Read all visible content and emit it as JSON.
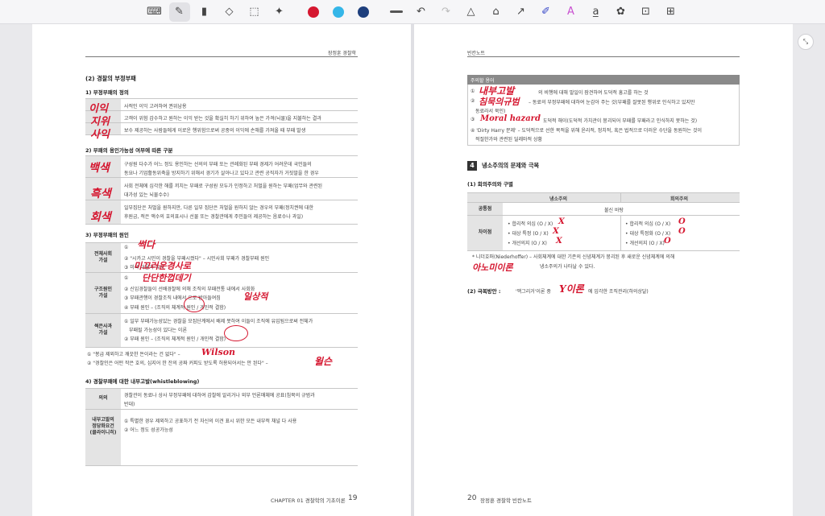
{
  "toolbar": {
    "tools": [
      {
        "name": "keyboard-icon",
        "glyph": "⌨"
      },
      {
        "name": "pen-icon",
        "glyph": "✎"
      },
      {
        "name": "highlighter-icon",
        "glyph": "▮"
      },
      {
        "name": "eraser-icon",
        "glyph": "◇"
      },
      {
        "name": "lasso-select-icon",
        "glyph": "⬚"
      },
      {
        "name": "magic-icon",
        "glyph": "✦"
      }
    ],
    "colors": [
      "#d51730",
      "#35b6e8",
      "#1e3f7d"
    ],
    "right_tools": [
      {
        "name": "undo-icon",
        "glyph": "↶"
      },
      {
        "name": "redo-icon",
        "glyph": "↷"
      },
      {
        "name": "shape-icon",
        "glyph": "△"
      },
      {
        "name": "tag-icon",
        "glyph": "⌂"
      },
      {
        "name": "arrow-icon",
        "glyph": "↗"
      },
      {
        "name": "marker-icon",
        "glyph": "✐"
      },
      {
        "name": "text-style-icon",
        "glyph": "A"
      },
      {
        "name": "text-box-icon",
        "glyph": "a̲"
      },
      {
        "name": "sticker-icon",
        "glyph": "✿"
      },
      {
        "name": "lock-icon",
        "glyph": "🔒"
      },
      {
        "name": "grid-icon",
        "glyph": "⊞"
      }
    ]
  },
  "left_page": {
    "header": "장정훈 경찰학",
    "section_title": "(2) 경찰의 부정부패",
    "s1_title": "1) 부정부패의 정의",
    "s1_rows": [
      "사적인 이익 고려하여 권위남용",
      "고객이 위험 감수하고 원하는 이익 받는 것을 확실히 하기 위하여 높은 가격(뇌물)을 지불하는 결과",
      "보수 제공하는 사람들에게 이로운 행위함으로써 공중의 이익에 손해를 가져올 때 부패 발생"
    ],
    "s2_title": "2) 부패의 용인가능성 여부에 따른 구분",
    "s2_rows": [
      "구성원 다수가 어느 정도 용인하는 선의의 부패 또는 관례화된 부패 경제가 어려운데 국민들의",
      "동요나 기업활동위축을 방지하기 위해서 경기가 살아나고 있다고 관련 공직자가 거짓말을 한 경우",
      "사회 전체에 심각한 해를 끼치는 부패로 구성원 모두가 인정하고 처벌을 원하는 부패(업무와 관련된",
      "대가성 있는 뇌물수수)",
      "일부집단은 처벌을 원하지만, 다른 일부 집단은 처벌을 원하지 않는 경우의 부패(정치권에 대한",
      "후원금, 적은 액수의 호의표시나 선물 또는 경찰관에게 주민들이 제공하는 음료수나 과일)"
    ],
    "s3_title": "3) 부정부패의 원인",
    "s3_groups": [
      {
        "label": "전체사회\n가설",
        "lines": [
          "①",
          "② \"시카고 시민이 경찰을 부패시켰다\" – 시민사회 부패가 경찰부패 원인",
          "③ 미국 이론과 유사"
        ]
      },
      {
        "label": "구조원인\n가설",
        "lines": [
          "①",
          "② 신임경찰들이 선배경찰에 의해 조직의 부패전통 내에서 사회화",
          "③ 부패관행이 경찰조직 내에서 으로 받아들여짐",
          "④ 부패 원인 – (조직의 체계적 원인 / 개인적 결함)"
        ]
      },
      {
        "label": "썩은사과\n가설",
        "lines": [
          "① 일부 부패가능성있는 경찰을 모집단계에서 배제 못하여 이들이 조직에 유입됨으로써 전체가",
          "부패될 가능성이 있다는 이론",
          "② 부패 원인 – (조직의 체계적 원인 / 개인적 결함)"
        ]
      }
    ],
    "s3_notes": [
      "① \"봉급 제외하고 깨끗한 돈이라는 건 없다\" –",
      "② \"경찰인은 어떤 작은 호의, 심지어 한 잔의 공짜 커피도 받도록 허용되어서는 안 된다\" –"
    ],
    "s4_title": "4) 경찰부패에 대한 내부고발(whistleblowing)",
    "s4_rows": [
      {
        "label": "의의",
        "lines": [
          "경찰관이 동료나 상사 부정부패에 대하여 감찰에 알리거나 외부 언론매체에 공표(침묵의 규범과",
          "반대)"
        ]
      },
      {
        "label": "내부고발의\n정당화요건\n(클라이니히)",
        "lines": [
          "① 특별한 경우 제외하고 공표하기 전 자신의 이견 표시 위한 모든 내부적 채널 다 사용",
          "② 어느 정도 성공가능성"
        ]
      }
    ],
    "footer_chapter": "CHAPTER 01  경찰학의 기초이론",
    "footer_page": "19"
  },
  "right_page": {
    "header": "빈칸노트",
    "box_title": "주의할 용어",
    "box_lines": [
      "①",
      "의 비행에 대해 말일이 잠견하여 도덕적 흥고를 하는 것",
      "②",
      "– 동료의 부정부패에 대하여 눈감아 주는 것(부패를 잘못된 행위로 인식하고 있지만",
      "동료라서 묵인)",
      "③",
      "도덕적 해이(도덕적 가치관이 붕괴되어 부패를 부패라고 인식하지 못하는 것)",
      "④ 'Dirty Harry 문제' – 도덕적으로 선한 목적을 위해 윤리적, 정치적, 혹은 법적으로 더러운 수단을 동원하는 것이",
      "적절한가와 관련된 딜레마적 상황"
    ],
    "sec4_num": "4",
    "sec4_title": "냉소주의의 문제와 극복",
    "sub1": "(1) 회의주의와 구별",
    "table_head": [
      "냉소주의",
      "회의주의"
    ],
    "common_label": "공통점",
    "common_val": "불신 바탕",
    "diff_label": "차이점",
    "diff_left": [
      "• 합리적 의심 (O / X)",
      "• 대상 특정 (O / X)",
      "• 개선의지 (O / X)"
    ],
    "diff_right": [
      "• 합리적 의심 (O / X)",
      "• 대상 특정화 (O / X)",
      "• 개선의지 (O / X)"
    ],
    "note1": "* 니더호퍼(Niederhoffer) – 사회체계에 대한 기존의 신념체계가 붕괴된 후 새로운 신념체계에 의해",
    "note2": "냉소주의가 나타날 수 있다.",
    "sub2": "(2) 극복방안 :",
    "sub2_text": "'맥그리거'이론 중",
    "sub2_tail": "에 입각한 조직관리(하의상달)",
    "footer_page": "20",
    "footer_title": "장정훈 경찰학 빈칸노트"
  },
  "ink": {
    "l1": "이익",
    "l2": "지위",
    "l3": "사익",
    "l4": "백색",
    "l5": "흑색",
    "l6": "회색",
    "l7": "썩다",
    "l8": "미끄러운경사로",
    "l9": "단단한껍데기",
    "l10": "일상적",
    "l11": "Wilson",
    "l12": "윌슨",
    "r1": "내부고발",
    "r2": "침묵의규범",
    "r3": "Moral hazard",
    "r4": "O",
    "r5": "O",
    "r6": "O",
    "r7": "X",
    "r8": "X",
    "r9": "X",
    "r10": "아노미이론",
    "r11": "Y이론"
  }
}
